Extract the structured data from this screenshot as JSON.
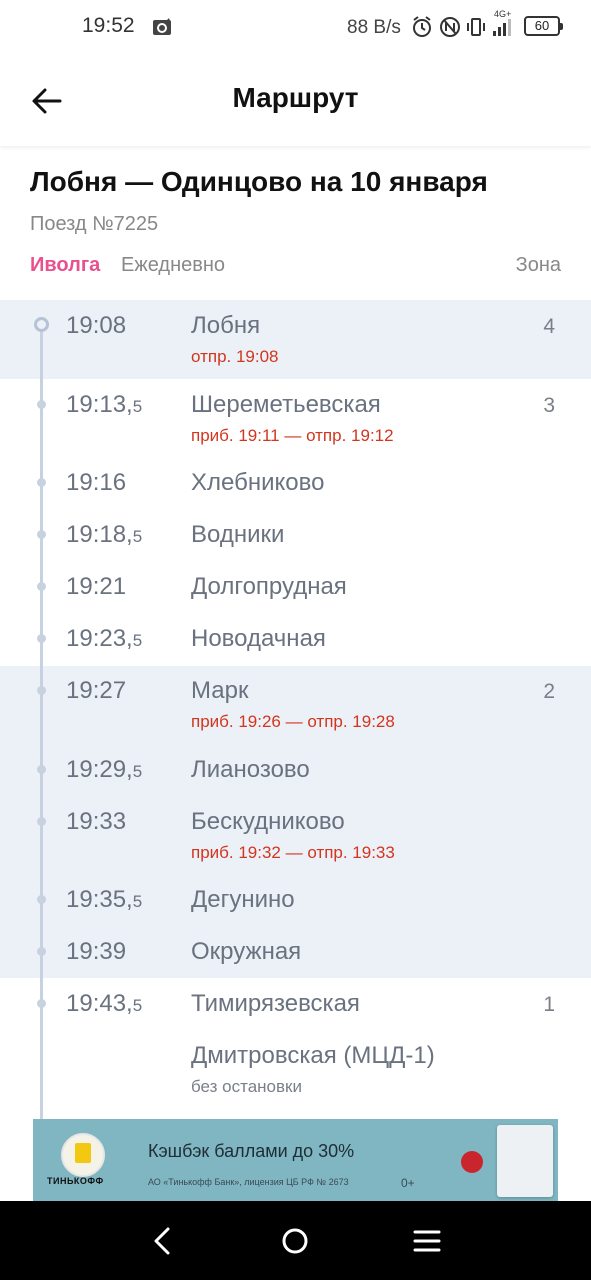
{
  "status_bar": {
    "time": "19:52",
    "network_speed": "88 B/s",
    "network_type": "4G+",
    "battery": "60"
  },
  "app_bar": {
    "title": "Маршрут"
  },
  "route": {
    "title": "Лобня — Одинцово на 10 января",
    "train_number": "Поезд №7225",
    "brand": "Иволга",
    "schedule": "Ежедневно",
    "zone_header": "Зона"
  },
  "stops": [
    {
      "time": "19:08",
      "half": "",
      "name": "Лобня",
      "sub": "отпр. 19:08",
      "zone": "4"
    },
    {
      "time": "19:13,",
      "half": "5",
      "name": "Шереметьевская",
      "sub": "приб. 19:11 — отпр. 19:12",
      "zone": "3"
    },
    {
      "time": "19:16",
      "half": "",
      "name": "Хлебниково",
      "sub": "",
      "zone": ""
    },
    {
      "time": "19:18,",
      "half": "5",
      "name": "Водники",
      "sub": "",
      "zone": ""
    },
    {
      "time": "19:21",
      "half": "",
      "name": "Долгопрудная",
      "sub": "",
      "zone": ""
    },
    {
      "time": "19:23,",
      "half": "5",
      "name": "Новодачная",
      "sub": "",
      "zone": ""
    },
    {
      "time": "19:27",
      "half": "",
      "name": "Марк",
      "sub": "приб. 19:26 — отпр. 19:28",
      "zone": "2"
    },
    {
      "time": "19:29,",
      "half": "5",
      "name": "Лианозово",
      "sub": "",
      "zone": ""
    },
    {
      "time": "19:33",
      "half": "",
      "name": "Бескудниково",
      "sub": "приб. 19:32 — отпр. 19:33",
      "zone": ""
    },
    {
      "time": "19:35,",
      "half": "5",
      "name": "Дегунино",
      "sub": "",
      "zone": ""
    },
    {
      "time": "19:39",
      "half": "",
      "name": "Окружная",
      "sub": "",
      "zone": ""
    },
    {
      "time": "19:43,",
      "half": "5",
      "name": "Тимирязевская",
      "sub": "",
      "zone": "1"
    },
    {
      "time": "",
      "half": "",
      "name": "Дмитровская (МЦД-1)",
      "sub": "без остановки",
      "zone": ""
    }
  ],
  "ad": {
    "logo_text": "ТИНЬКОФФ",
    "title": "Кэшбэк баллами до 30%",
    "fine_print": "АО «Тинькофф Банк», лицензия ЦБ РФ № 2673",
    "age": "0+"
  },
  "nav": {
    "back_icon": "chevron-left-icon",
    "home_icon": "circle-home-icon",
    "menu_icon": "menu-lines-icon"
  },
  "colors": {
    "band": "#ecf0f7",
    "brand_pink": "#e8508f",
    "arrival_red": "#d2361e",
    "timeline": "#c7d1e0"
  }
}
